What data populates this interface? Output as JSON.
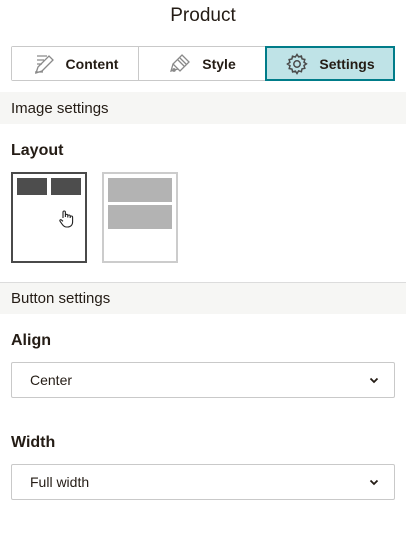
{
  "panel": {
    "title": "Product"
  },
  "tabs": [
    {
      "label": "Content",
      "icon": "pencil-icon"
    },
    {
      "label": "Style",
      "icon": "paint-icon"
    },
    {
      "label": "Settings",
      "icon": "gear-icon"
    }
  ],
  "active_tab": "Settings",
  "image_settings": {
    "heading": "Image settings",
    "layout_label": "Layout",
    "layout_options": [
      "side-by-side",
      "stacked"
    ],
    "selected_layout": "side-by-side"
  },
  "button_settings": {
    "heading": "Button settings",
    "align_label": "Align",
    "align_value": "Center",
    "width_label": "Width",
    "width_value": "Full width"
  },
  "colors": {
    "accent": "#007c89",
    "active_tab_bg": "#bfe3e7"
  }
}
